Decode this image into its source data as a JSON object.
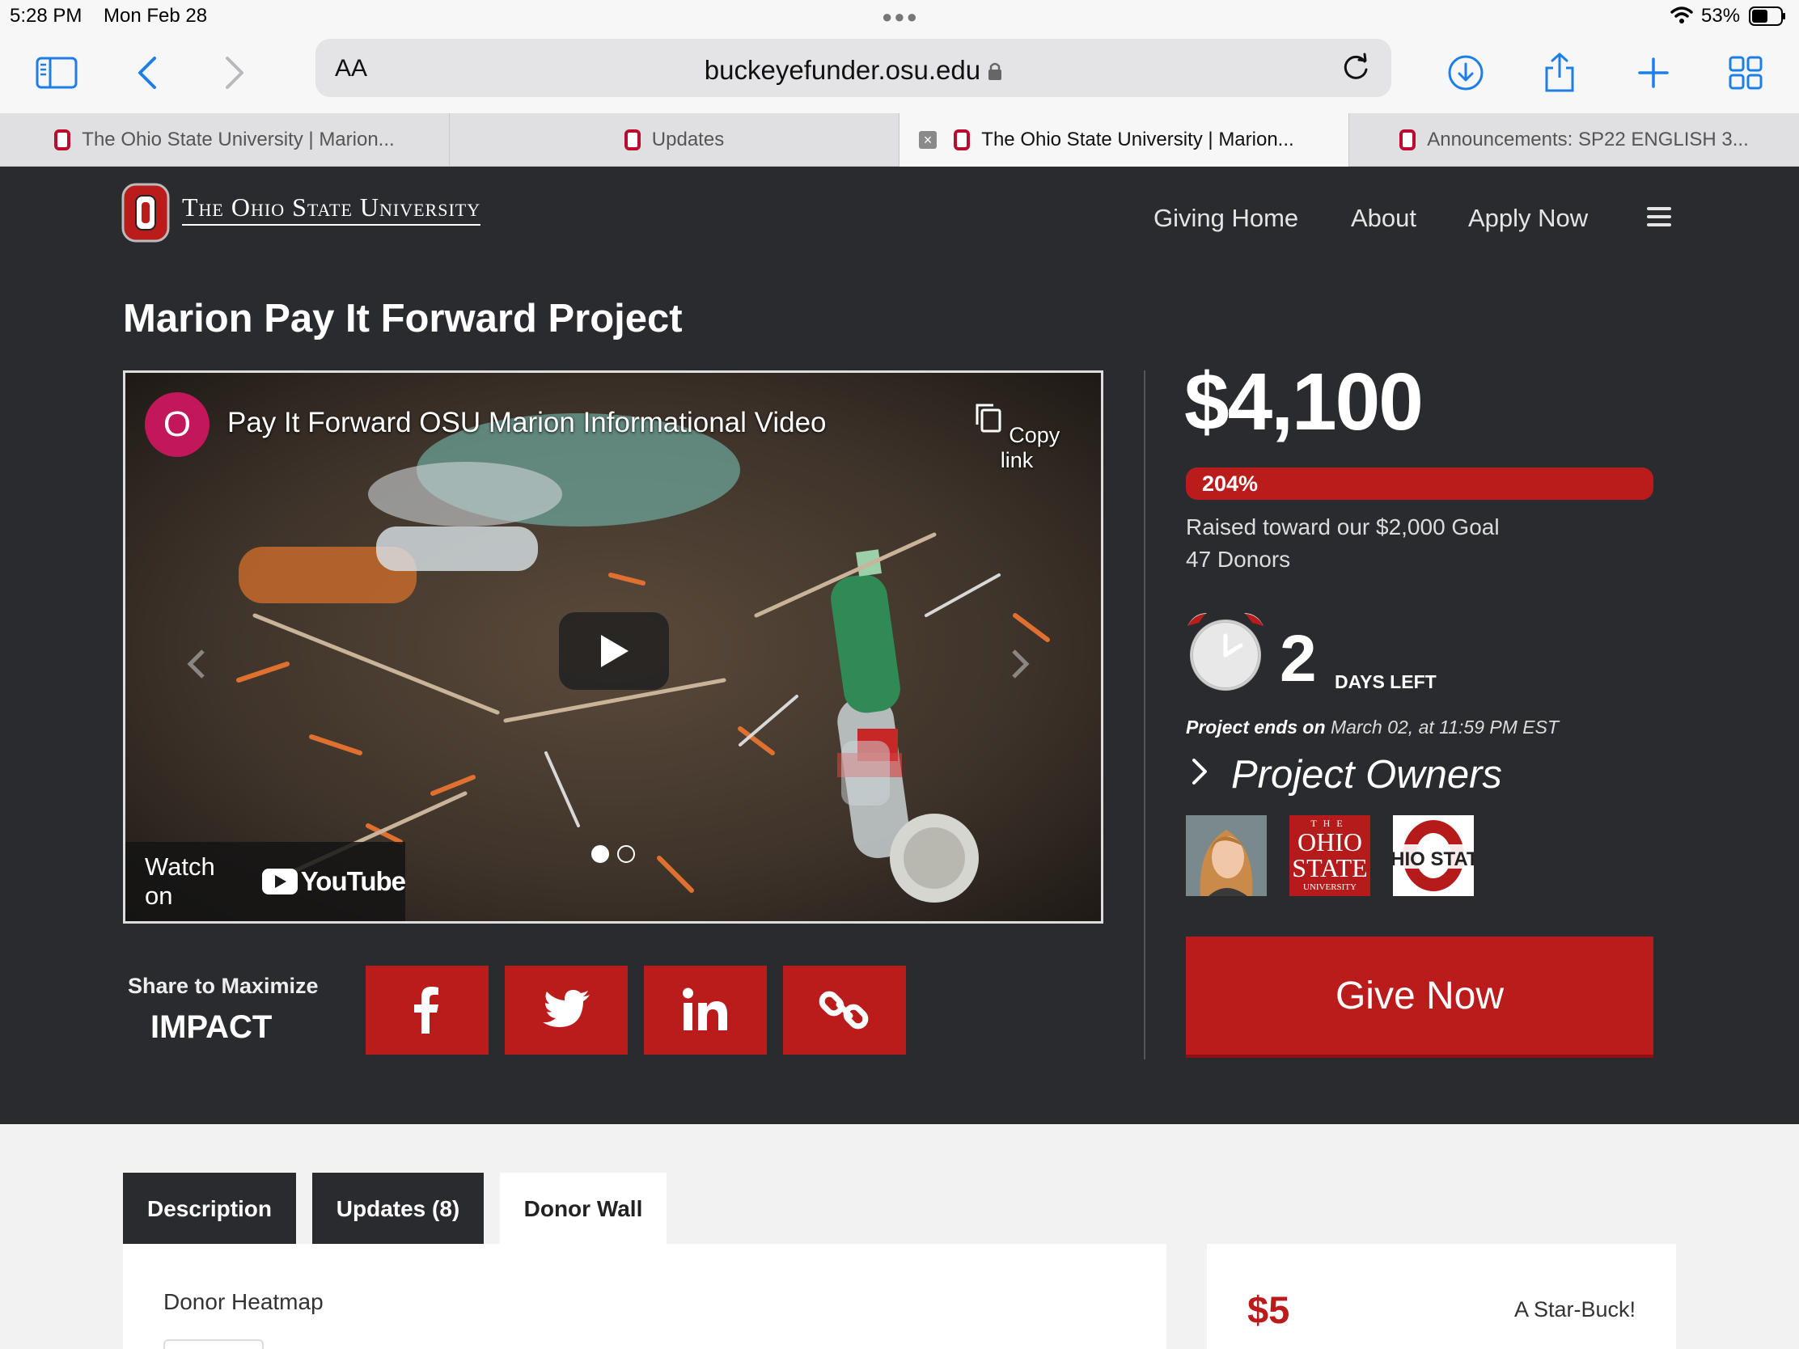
{
  "status_bar": {
    "time": "5:28 PM",
    "date": "Mon Feb 28",
    "battery": "53%"
  },
  "browser": {
    "address_text_size": "AA",
    "url": "buckeyefunder.osu.edu",
    "tabs": [
      {
        "title": "The Ohio State University | Marion...",
        "active": false
      },
      {
        "title": "Updates",
        "active": false
      },
      {
        "title": "The Ohio State University | Marion...",
        "active": true
      },
      {
        "title": "Announcements: SP22 ENGLISH 3...",
        "active": false
      }
    ]
  },
  "site": {
    "wordmark": "The Ohio State University",
    "nav": [
      "Giving Home",
      "About",
      "Apply Now"
    ]
  },
  "project": {
    "title": "Marion Pay It Forward Project",
    "video": {
      "channel_initial": "O",
      "title": "Pay It Forward OSU Marion Informational Video",
      "copy_link": "Copy link",
      "watch_on": "Watch on",
      "youtube": "YouTube"
    },
    "share": {
      "line1": "Share to Maximize",
      "line2": "IMPACT"
    },
    "amount": "$4,100",
    "percent_label": "204%",
    "progress_fraction": 1.0,
    "goal_text": "Raised toward our $2,000 Goal",
    "donors_text": "47 Donors",
    "days_left": "2",
    "days_left_label": "DAYS LEFT",
    "ends_prefix": "Project ends on",
    "ends_date": "March 02, at 11:59 PM EST",
    "owners_title": "Project Owners",
    "give_button": "Give Now"
  },
  "lower": {
    "tabs": [
      "Description",
      "Updates (8)",
      "Donor Wall"
    ],
    "heatmap_label": "Donor Heatmap",
    "reward": {
      "amount": "$5",
      "name": "A Star-Buck!"
    }
  },
  "colors": {
    "brand_red": "#ba1c1c",
    "dark_bg": "#2a2b2e",
    "ios_blue": "#1c7ee6"
  }
}
